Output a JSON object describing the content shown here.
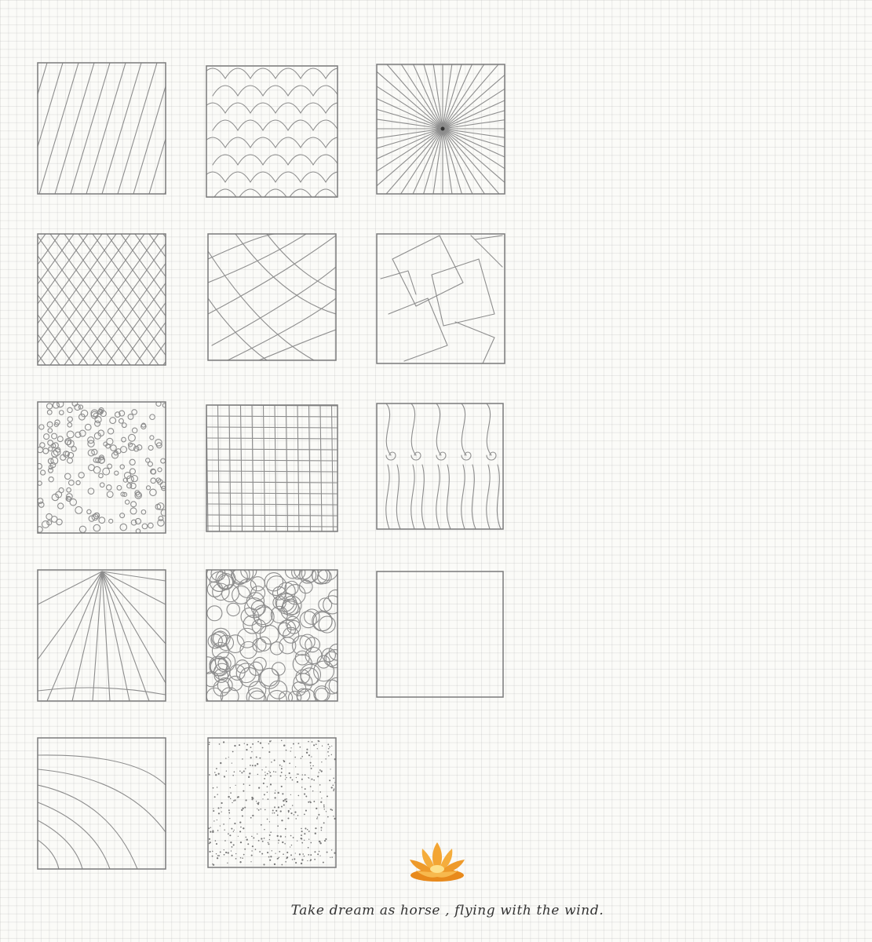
{
  "tiles": [
    {
      "pattern": "diagonal-lines"
    },
    {
      "pattern": "scales"
    },
    {
      "pattern": "radial-burst"
    },
    {
      "pattern": "cross-hatch"
    },
    {
      "pattern": "curved-bands"
    },
    {
      "pattern": "broken-squares"
    },
    {
      "pattern": "dots"
    },
    {
      "pattern": "grid"
    },
    {
      "pattern": "waves-swirls"
    },
    {
      "pattern": "fan-rays"
    },
    {
      "pattern": "overlapping-circles"
    },
    {
      "pattern": "empty"
    },
    {
      "pattern": "concentric-arcs"
    },
    {
      "pattern": "stipple"
    }
  ],
  "footer": {
    "icon": "lotus-flower-icon",
    "caption": "Take dream as horse , flying with the wind."
  },
  "colors": {
    "paper": "#fbfbf8",
    "pencil": "#8d8d8d",
    "lotus_petal": "#f0a32e",
    "lotus_center": "#fde08a"
  }
}
